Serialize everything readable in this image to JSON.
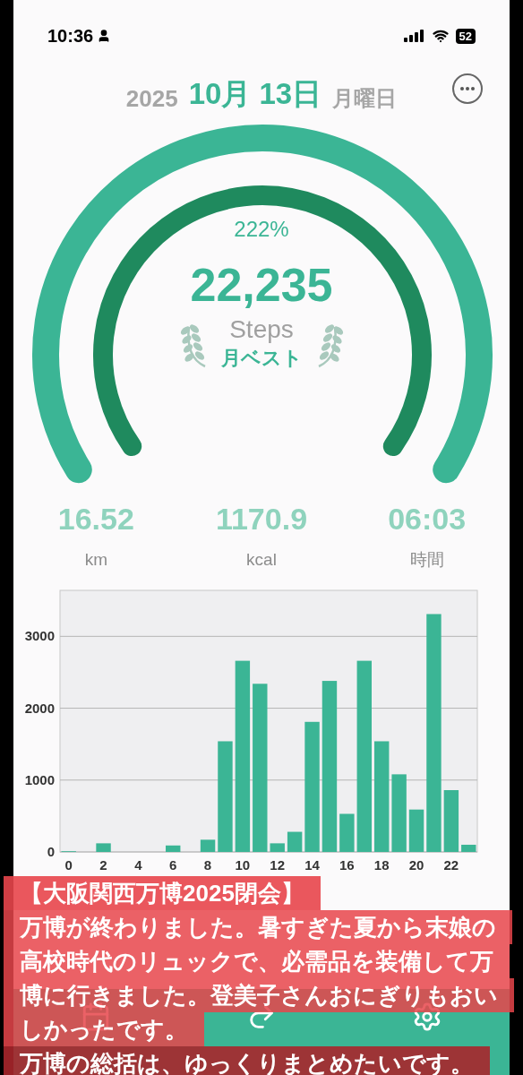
{
  "status_bar": {
    "time": "10:36",
    "battery": "52"
  },
  "date": {
    "year": "2025",
    "day": "10月 13日",
    "weekday": "月曜日"
  },
  "ring": {
    "percent": "222%",
    "steps": "22,235",
    "unit": "Steps",
    "badge": "月ベスト"
  },
  "stats": [
    {
      "value": "16.52",
      "label": "km"
    },
    {
      "value": "1170.9",
      "label": "kcal"
    },
    {
      "value": "06:03",
      "label": "時間"
    }
  ],
  "chart_data": {
    "type": "bar",
    "x": [
      0,
      1,
      2,
      3,
      4,
      5,
      6,
      7,
      8,
      9,
      10,
      11,
      12,
      13,
      14,
      15,
      16,
      17,
      18,
      19,
      20,
      21,
      22,
      23
    ],
    "series": [
      {
        "color": "#3bb595",
        "values": [
          10,
          0,
          120,
          0,
          0,
          0,
          90,
          0,
          170,
          1540,
          2660,
          2340,
          120,
          280,
          1810,
          2380,
          530,
          2660,
          1540,
          1080,
          590,
          3310,
          860,
          100
        ]
      }
    ],
    "xticks": [
      0,
      2,
      4,
      6,
      8,
      10,
      12,
      14,
      16,
      18,
      20,
      22
    ],
    "yticks": [
      0,
      1000,
      2000,
      3000
    ],
    "ylim": [
      0,
      3640
    ],
    "xlim": [
      -0.5,
      23.5
    ],
    "grid": true
  },
  "caption": {
    "title": "【大阪関西万博2025閉会】",
    "lines": [
      "万博が終わりました。暑すぎた夏から末娘の",
      "高校時代のリュックで、必需品を装備して万",
      "博に行きました。登美子さんおにぎりもおい",
      "しかったです。",
      "万博の総括は、ゆっくりまとめたいです。"
    ]
  }
}
